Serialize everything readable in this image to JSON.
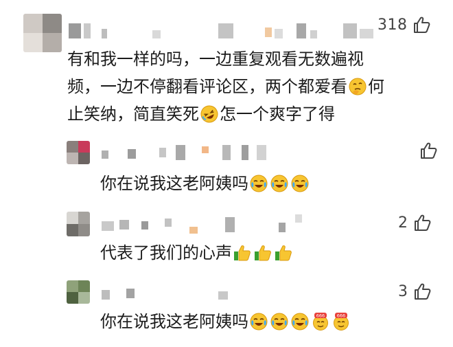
{
  "comments": [
    {
      "likes": "318",
      "text_lines": [
        "有和我一样的吗，一边重复观看无数遍视",
        "频，一边不停翻看评论区，两个都爱看",
        "止笑纳，简直笑死",
        "怎一个爽字了得"
      ],
      "tail_lines": [
        "何"
      ],
      "emoji": [
        "thinking-face",
        "rofl-face"
      ]
    },
    {
      "likes": "",
      "text": "你在说我这老阿姨吗",
      "emoji": [
        "crying-laughing-face",
        "crying-laughing-face",
        "crying-laughing-face"
      ]
    },
    {
      "likes": "2",
      "text": "代表了我们的心声",
      "emoji": [
        "thumbs-up",
        "thumbs-up",
        "thumbs-up"
      ]
    },
    {
      "likes": "3",
      "text": "你在说我这老阿姨吗",
      "emoji": [
        "crying-laughing-face",
        "crying-laughing-face",
        "crying-laughing-face",
        "666-face",
        "666-face"
      ],
      "badge_text": "666"
    }
  ]
}
